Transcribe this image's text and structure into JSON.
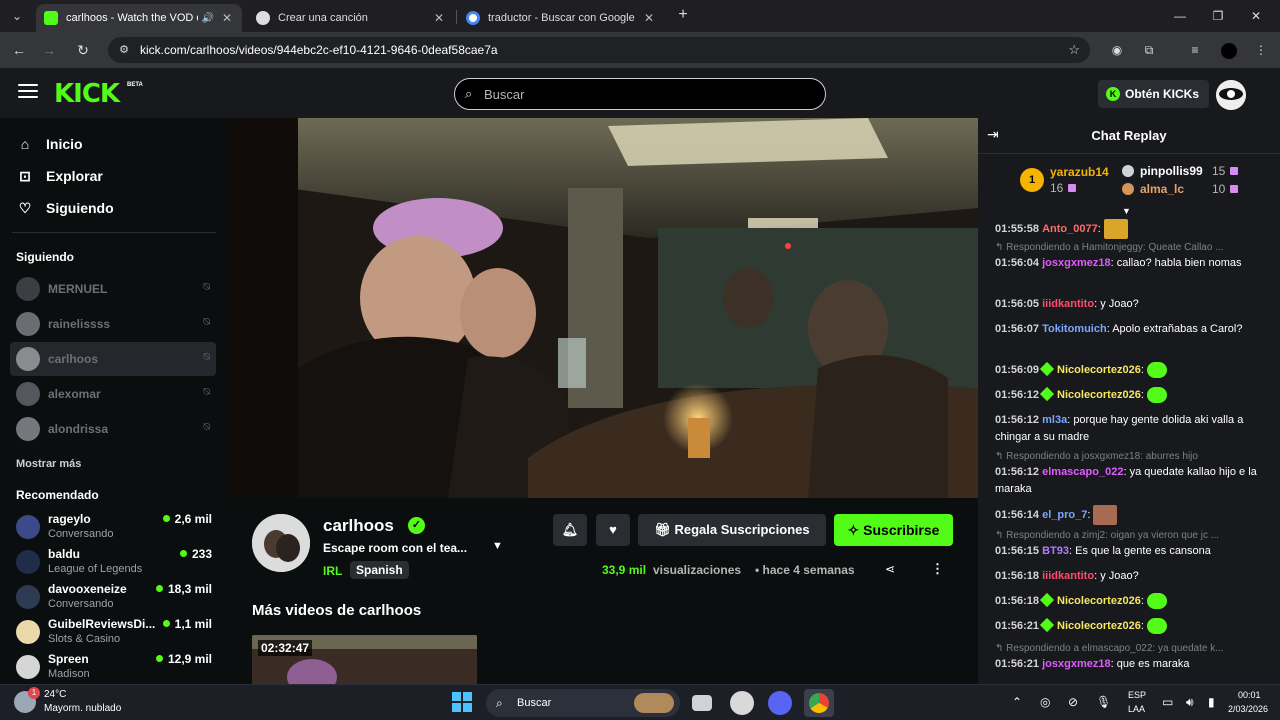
{
  "browser": {
    "tabs": [
      {
        "title": "carlhoos - Watch the VOD o",
        "active": true
      },
      {
        "title": "Crear una canción",
        "active": false
      },
      {
        "title": "traductor - Buscar con Google",
        "active": false
      }
    ],
    "url": "kick.com/carlhoos/videos/944ebc2c-ef10-4121-9646-0deaf58cae7a"
  },
  "header": {
    "logo": "KICK",
    "beta": "BETA",
    "search_placeholder": "Buscar",
    "kicks_label": "Obtén KICKs"
  },
  "sidebar": {
    "nav": [
      {
        "label": "Inicio",
        "icon": "home-icon"
      },
      {
        "label": "Explorar",
        "icon": "compass-icon"
      },
      {
        "label": "Siguiendo",
        "icon": "heart-icon"
      }
    ],
    "following_heading": "Siguiendo",
    "following": [
      {
        "name": "MERNUEL"
      },
      {
        "name": "rainelissss"
      },
      {
        "name": "carlhoos"
      },
      {
        "name": "alexomar"
      },
      {
        "name": "alondrissa"
      }
    ],
    "show_more": "Mostrar más",
    "recommended_heading": "Recomendado",
    "recommended": [
      {
        "name": "rageylo",
        "category": "Conversando",
        "viewers": "2,6 mil"
      },
      {
        "name": "baldu",
        "category": "League of Legends",
        "viewers": "233"
      },
      {
        "name": "davooxeneize",
        "category": "Conversando",
        "viewers": "18,3 mil"
      },
      {
        "name": "GuibelReviewsDi...",
        "category": "Slots & Casino",
        "viewers": "1,1 mil"
      },
      {
        "name": "Spreen",
        "category": "Madison",
        "viewers": "12,9 mil"
      }
    ]
  },
  "channel": {
    "name": "carlhoos",
    "title": "Escape room con el tea...",
    "tag": "IRL",
    "language": "Spanish",
    "gift_label": "Regala Suscripciones",
    "subscribe_label": "Suscribirse",
    "views": "33,9 mil",
    "views_label": "visualizaciones",
    "ago": "hace 4 semanas",
    "more_videos_heading": "Más videos de carlhoos",
    "thumb_duration": "02:32:47"
  },
  "chat": {
    "title": "Chat Replay",
    "leaderboard": [
      {
        "rank": "1",
        "name": "yarazub14",
        "count": "16"
      },
      {
        "name": "pinpollis99",
        "count": "15"
      },
      {
        "name": "alma_lc",
        "count": "10"
      }
    ],
    "messages": [
      {
        "time": "01:55:58",
        "user": "Anto_0077",
        "color": "#ff6b6b",
        "text": ""
      },
      {
        "reply": "Respondiendo a Hamitonjeggy: Queate Callao ..."
      },
      {
        "time": "01:56:04",
        "user": "josxgxmez18",
        "color": "#e05cff",
        "text": "callao? habla bien nomas"
      },
      {
        "time": "01:56:05",
        "user": "iiidkantito",
        "color": "#ff4d6d",
        "text": "y Joao?"
      },
      {
        "time": "01:56:07",
        "user": "Tokitomuich",
        "color": "#7aa7ff",
        "text": "Apolo extrañabas a Carol?"
      },
      {
        "time": "01:56:09",
        "user": "Nicolecortez026",
        "color": "#f5e663",
        "text": ""
      },
      {
        "time": "01:56:12",
        "user": "Nicolecortez026",
        "color": "#f5e663",
        "text": ""
      },
      {
        "time": "01:56:12",
        "user": "ml3a",
        "color": "#7aa7ff",
        "text": "porque hay gente dolida aki valla a chingar a su madre"
      },
      {
        "reply": "Respondiendo a josxgxmez18: aburres hijo"
      },
      {
        "time": "01:56:12",
        "user": "elmascapo_022",
        "color": "#e05cff",
        "text": "ya quedate kallao hijo e la maraka"
      },
      {
        "time": "01:56:14",
        "user": "el_pro_7",
        "color": "#7aa7ff",
        "text": ""
      },
      {
        "reply": "Respondiendo a zimj2: oigan ya vieron que jc ..."
      },
      {
        "time": "01:56:15",
        "user": "BT93",
        "color": "#b57aff",
        "text": "Es que la gente es cansona"
      },
      {
        "time": "01:56:18",
        "user": "iiidkantito",
        "color": "#ff4d6d",
        "text": "y Joao?"
      },
      {
        "time": "01:56:18",
        "user": "Nicolecortez026",
        "color": "#f5e663",
        "text": ""
      },
      {
        "time": "01:56:21",
        "user": "Nicolecortez026",
        "color": "#f5e663",
        "text": ""
      },
      {
        "reply": "Respondiendo a elmascapo_022: ya quedate k..."
      },
      {
        "time": "01:56:21",
        "user": "josxgxmez18",
        "color": "#e05cff",
        "text": "que es maraka"
      }
    ]
  },
  "taskbar": {
    "weather_badge": "1",
    "temp": "24°C",
    "condition": "Mayorm. nublado",
    "search_label": "Buscar",
    "lang1": "ESP",
    "lang2": "LAA",
    "time": "00:01",
    "date": "2/03/2026"
  },
  "colors": {
    "brand": "#53fc18",
    "bg": "#0b0e0f",
    "panel": "#18191c"
  }
}
